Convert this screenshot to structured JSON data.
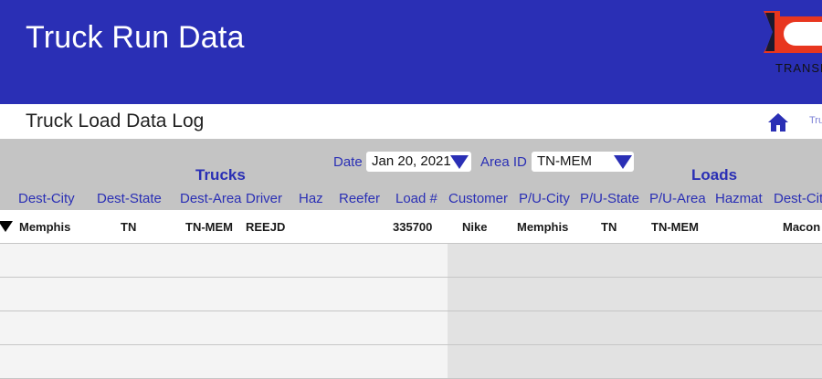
{
  "header": {
    "app_title": "Truck Run Data",
    "logo_caption": "TRANSP",
    "background_color": "#2a2fb5",
    "logo_colors": {
      "red": "#e8361f",
      "white": "#ffffff",
      "dark": "#1a1a2e"
    }
  },
  "subheader": {
    "page_title": "Truck Load Data Log",
    "home_icon": "home-icon",
    "breadcrumb": "Tru"
  },
  "filters": {
    "date_label": "Date",
    "date_value": "Jan 20, 2021",
    "area_label": "Area ID",
    "area_value": "TN-MEM"
  },
  "groups": {
    "trucks": "Trucks",
    "loads": "Loads"
  },
  "columns": {
    "dest_city": "Dest-City",
    "dest_state": "Dest-State",
    "dest_area": "Dest-Area",
    "driver": "Driver",
    "haz": "Haz",
    "reefer": "Reefer",
    "load_no": "Load #",
    "customer": "Customer",
    "pu_city": "P/U-City",
    "pu_state": "P/U-State",
    "pu_area": "P/U-Area",
    "hazmat": "Hazmat",
    "dest_city_2": "Dest-Cit"
  },
  "rows": [
    {
      "dest_city": "Memphis",
      "dest_state": "TN",
      "dest_area": "TN-MEM",
      "driver": "REEJD",
      "haz": "",
      "reefer": "",
      "load_no": "335700",
      "customer": "Nike",
      "pu_city": "Memphis",
      "pu_state": "TN",
      "pu_area": "TN-MEM",
      "hazmat": "",
      "dest_city_2": "Macon"
    },
    {},
    {},
    {},
    {}
  ],
  "colors": {
    "accent": "#2a2fb5",
    "filterbar_bg": "#c4c4c4",
    "trucks_rows_bg": "#f4f4f4",
    "loads_rows_bg": "#e2e2e2"
  }
}
